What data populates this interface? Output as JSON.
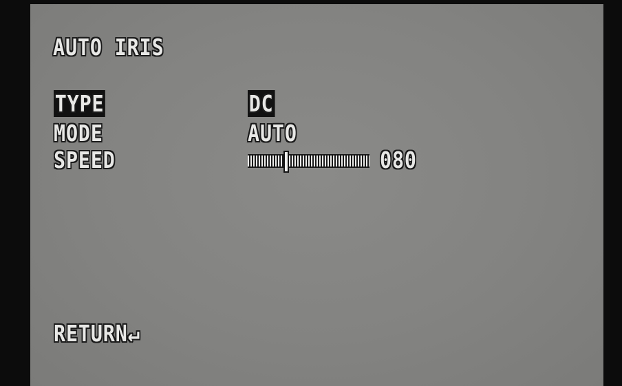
{
  "menu": {
    "title": "AUTO IRIS",
    "items": [
      {
        "label": "TYPE",
        "value": "DC"
      },
      {
        "label": "MODE",
        "value": "AUTO"
      },
      {
        "label": "SPEED",
        "value": "080"
      }
    ],
    "speed_slider": {
      "value": 80,
      "min": 0,
      "max": 255
    },
    "return_label": "RETURN",
    "return_icon": "enter-arrow-icon",
    "return_glyph": "↵",
    "selected_item": "TYPE"
  },
  "colors": {
    "background": "#848482",
    "text": "#e8e8e6",
    "outline": "#1a1a1a",
    "highlight": "#111111",
    "border": "#0c0c0c"
  }
}
